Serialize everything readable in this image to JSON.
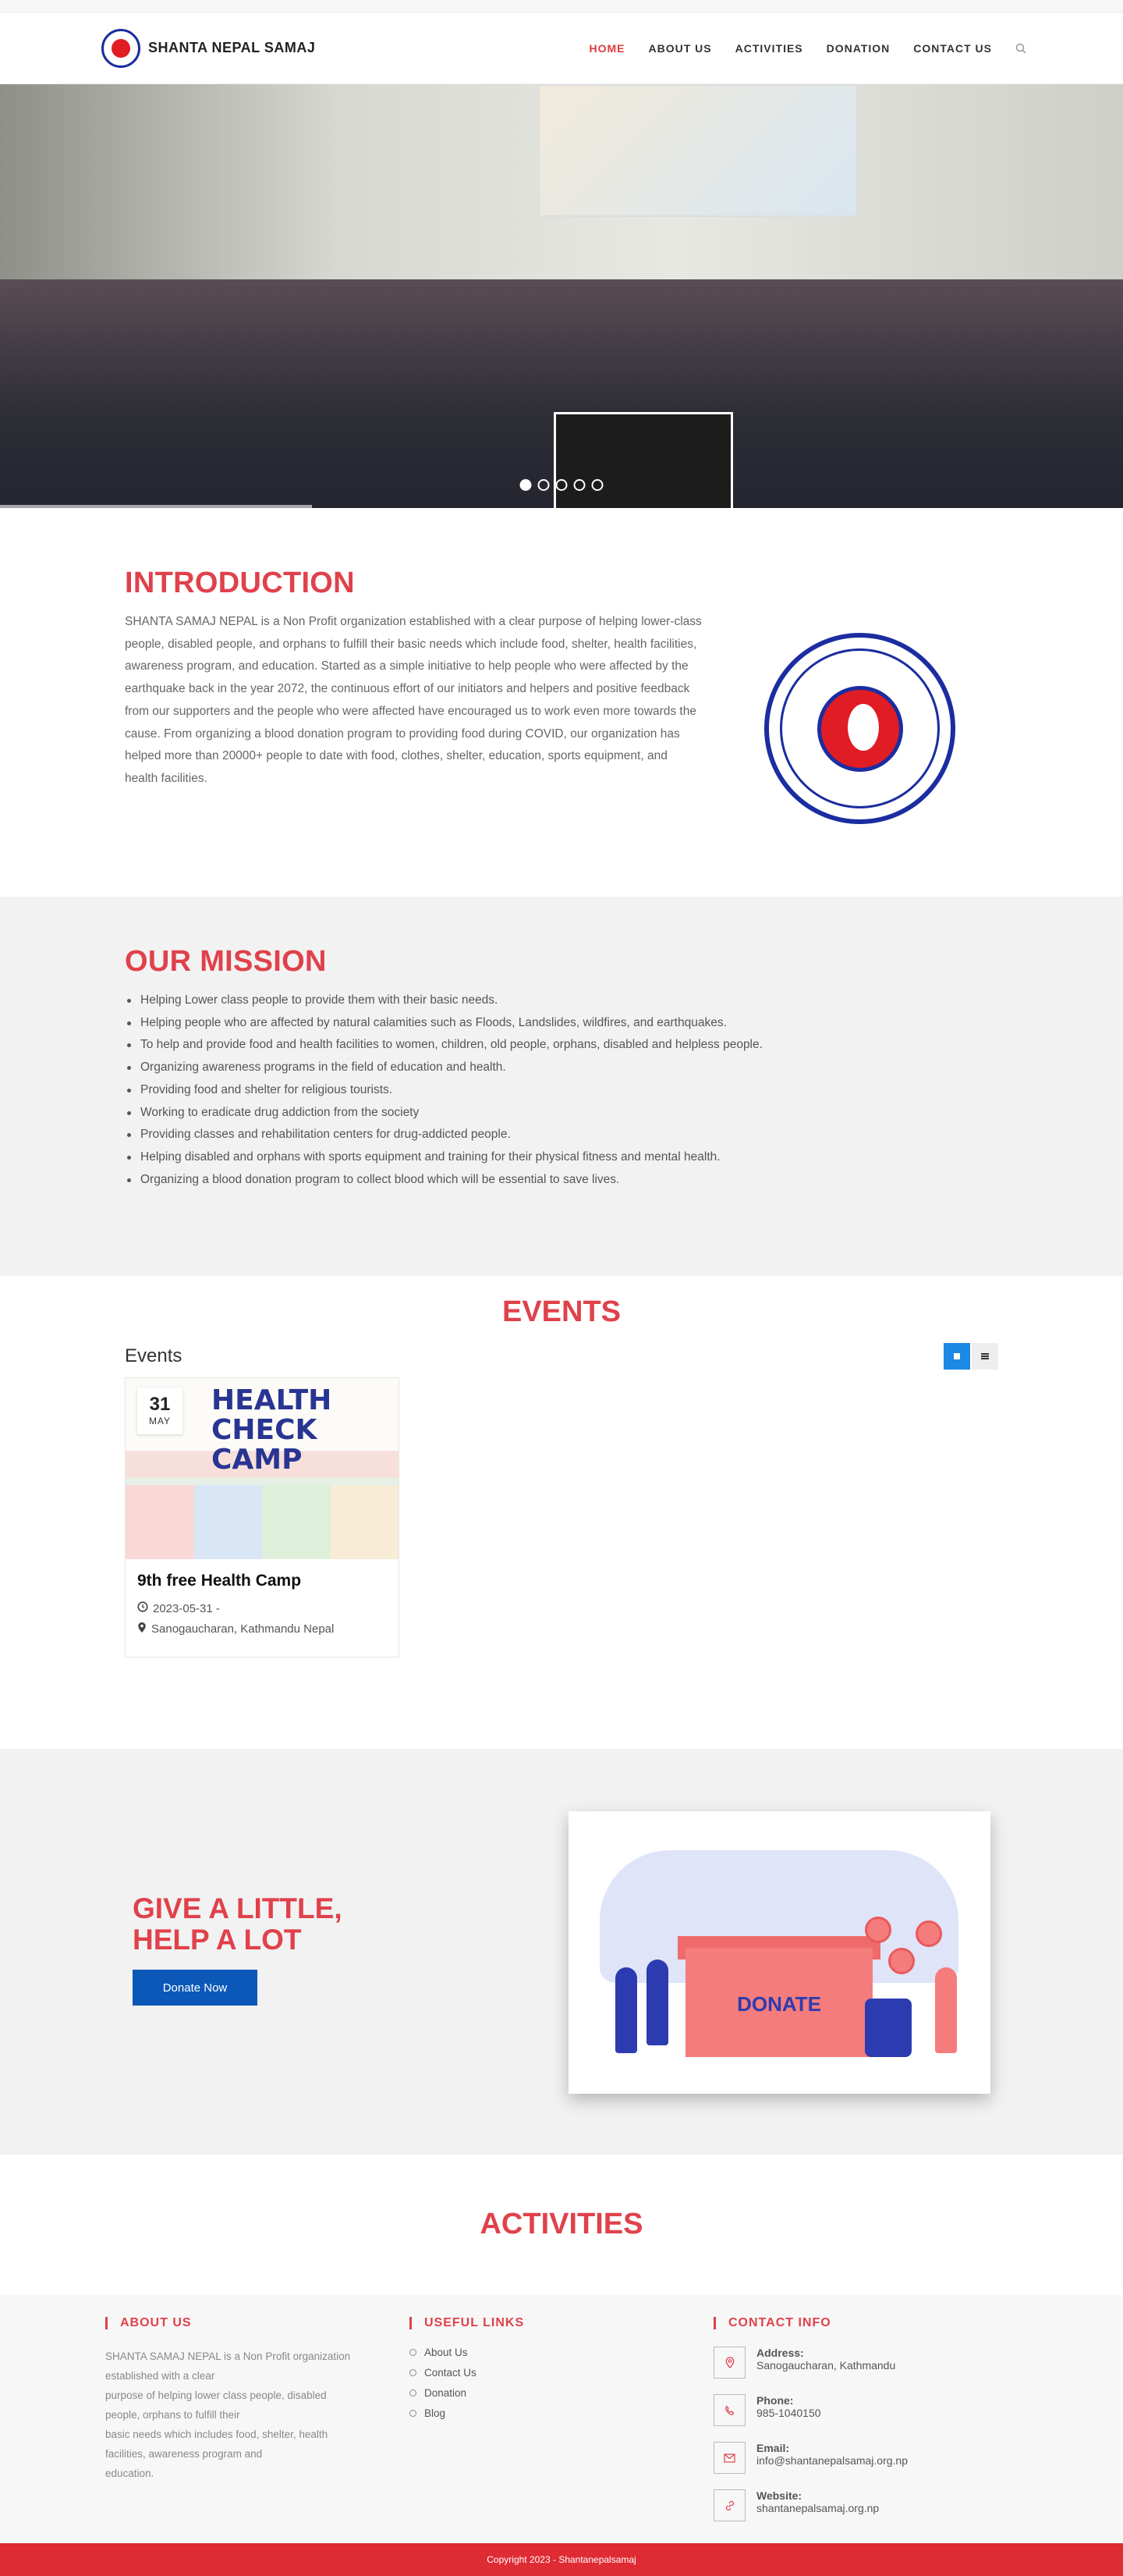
{
  "brand": {
    "name": "SHANTA NEPAL SAMAJ"
  },
  "nav": {
    "items": [
      {
        "label": "HOME",
        "active": true
      },
      {
        "label": "ABOUT US",
        "active": false
      },
      {
        "label": "ACTIVITIES",
        "active": false
      },
      {
        "label": "DONATION",
        "active": false
      },
      {
        "label": "CONTACT US",
        "active": false
      }
    ]
  },
  "hero": {
    "slides": 5,
    "active_slide": 1
  },
  "intro": {
    "title": "INTRODUCTION",
    "body": "SHANTA SAMAJ NEPAL is a Non Profit organization established with a clear purpose of helping lower-class people, disabled people, and orphans to fulfill their basic needs which include food, shelter, health facilities, awareness program, and education. Started as a simple initiative to help people who were affected by the earthquake back in the year 2072, the continuous effort of our initiators and helpers and positive feedback from our supporters and the people who were affected have encouraged us to work even more towards the cause. From organizing a blood donation program to providing food during COVID, our organization has helped more than 20000+ people to date with food, clothes, shelter, education, sports equipment, and health facilities."
  },
  "mission": {
    "title": "OUR MISSION",
    "items": [
      "Helping Lower class people to provide them with their basic needs.",
      "Helping people who are affected by natural calamities such as Floods, Landslides, wildfires, and earthquakes.",
      "To help and provide food and health facilities to women, children, old people, orphans, disabled and helpless people.",
      "Organizing awareness programs in the field of education and health.",
      "Providing food and shelter for religious tourists.",
      "Working to eradicate drug addiction from the society",
      "Providing classes and rehabilitation centers for drug-addicted people.",
      "Helping disabled and orphans with sports equipment and training for their physical fitness and mental health.",
      "Organizing a blood donation program to collect blood which will be essential to save lives."
    ]
  },
  "events": {
    "title": "EVENTS",
    "label": "Events",
    "cards": [
      {
        "day": "31",
        "month": "MAY",
        "poster_text": "HEALTH CHECK CAMP",
        "title": "9th free Health Camp",
        "date": "2023-05-31 -",
        "location": "Sanogaucharan, Kathmandu Nepal"
      }
    ]
  },
  "donate": {
    "headline_1": "GIVE A LITTLE,",
    "headline_2": "HELP A LOT",
    "button": "Donate Now",
    "illustration_word": "DONATE"
  },
  "activities": {
    "title": "ACTIVITIES"
  },
  "footer": {
    "about_title": "ABOUT US",
    "about_lines": [
      "SHANTA SAMAJ NEPAL is a Non Profit organization",
      "established with a clear",
      "purpose of helping lower class people, disabled",
      "people, orphans to fulfill their",
      "basic needs which includes food, shelter, health",
      "facilities, awareness program and",
      "education."
    ],
    "links_title": "USEFUL LINKS",
    "links": [
      "About Us",
      "Contact Us",
      "Donation",
      "Blog"
    ],
    "contact_title": "CONTACT INFO",
    "contact": [
      {
        "key": "Address:",
        "value": "Sanogaucharan, Kathmandu",
        "icon": "map-pin-icon"
      },
      {
        "key": "Phone:",
        "value": "985-1040150",
        "icon": "phone-icon"
      },
      {
        "key": "Email:",
        "value": "info@shantanepalsamaj.org.np",
        "icon": "envelope-icon"
      },
      {
        "key": "Website:",
        "value": "shantanepalsamaj.org.np",
        "icon": "link-icon"
      }
    ],
    "copyright": "Copyright 2023 - Shantanepalsamaj"
  },
  "colors": {
    "accent": "#e0414b",
    "button": "#0b58b8",
    "footer_bar": "#df2b33",
    "seal_blue": "#1b2da0"
  }
}
